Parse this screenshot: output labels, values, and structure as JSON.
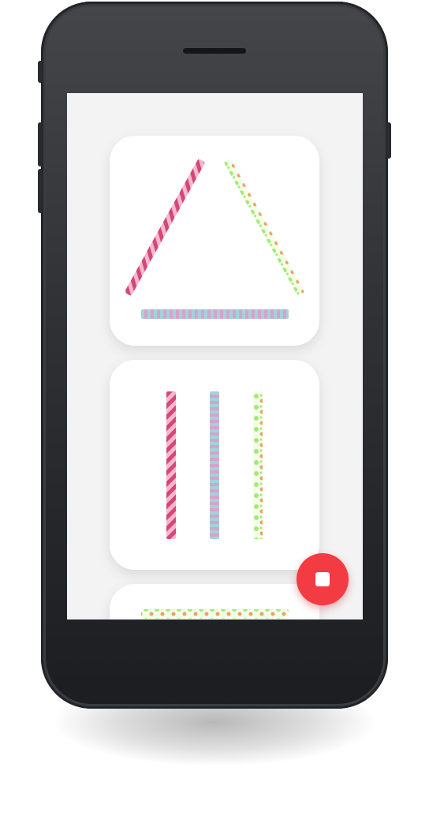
{
  "app": {
    "background": "#f3f3f3",
    "card_background": "#ffffff"
  },
  "patterns": {
    "pink_stripes": [
      "#d4477a",
      "#f4b8cc"
    ],
    "blue_pink_stripes": [
      "#9fd3e0",
      "#d7a3c8"
    ],
    "green_orange_dots": [
      "#a6e878",
      "#f0a060"
    ]
  },
  "cards": [
    {
      "name": "triangle",
      "arrangement": "triangle",
      "sticks": [
        "pink_stripes",
        "green_orange_dots",
        "blue_pink_stripes"
      ]
    },
    {
      "name": "three-vertical",
      "arrangement": "three-vertical",
      "sticks": [
        "pink_stripes",
        "blue_pink_stripes",
        "green_orange_dots"
      ]
    },
    {
      "name": "single-horizontal",
      "arrangement": "horizontal",
      "sticks": [
        "green_orange_dots"
      ]
    }
  ],
  "fab": {
    "icon": "stop-icon",
    "color": "#f23b42"
  }
}
